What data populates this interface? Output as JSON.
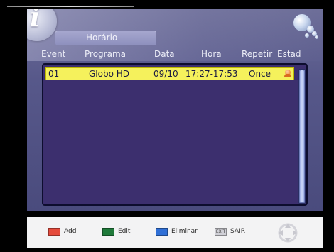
{
  "screen": {
    "title": "Horário",
    "info_symbol": "i"
  },
  "table": {
    "columns": [
      "Event",
      "Programa",
      "Data",
      "Hora",
      "Repetir",
      "Estad"
    ],
    "rows": [
      {
        "event": "01",
        "programa": "Globo HD",
        "data": "09/10",
        "hora": "17:27-17:53",
        "repetir": "Once",
        "status_icon": "person-status-icon",
        "selected": true
      }
    ]
  },
  "footer": {
    "legend": [
      {
        "label": "Add",
        "color": "#e54b3c",
        "key": "red"
      },
      {
        "label": "Edit",
        "color": "#1f7a3a",
        "key": "green"
      },
      {
        "label": "Eliminar",
        "color": "#2f6fd6",
        "key": "blue"
      },
      {
        "label": "SAIR",
        "chip_text": "EXIT",
        "key": "exit"
      }
    ],
    "nav_icon": "directional-pad-icon"
  },
  "colors": {
    "row_highlight": "#f5f15c",
    "panel_bg": "#3c2f6e",
    "frame_bg": "#57588a"
  }
}
